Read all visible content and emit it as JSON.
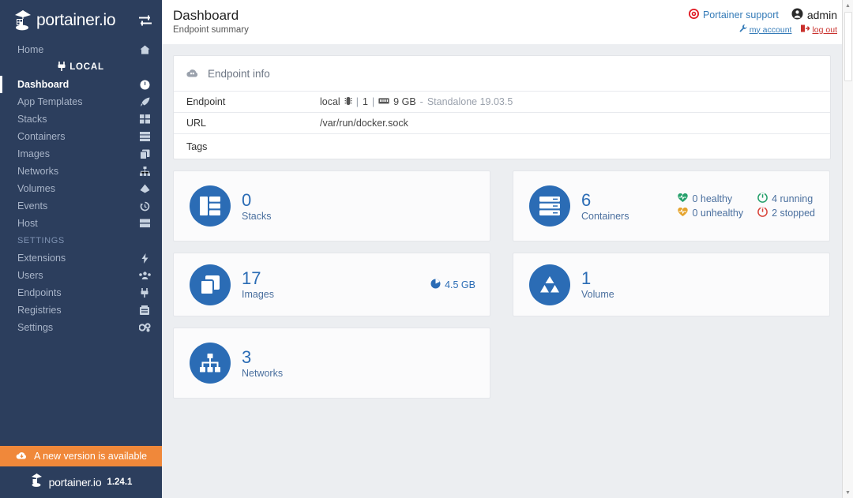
{
  "brand": {
    "name": "portainer.io",
    "toggle_icon": "sliders-toggle-icon",
    "logo_icon": "portainer-whale-logo"
  },
  "sidebar": {
    "home": {
      "label": "Home",
      "icon": "home-icon"
    },
    "local": {
      "label": "LOCAL",
      "icon": "plug-icon"
    },
    "items": [
      {
        "label": "Dashboard",
        "icon": "tachometer-icon",
        "active": true
      },
      {
        "label": "App Templates",
        "icon": "rocket-icon",
        "active": false
      },
      {
        "label": "Stacks",
        "icon": "stacks-grid-icon",
        "active": false
      },
      {
        "label": "Containers",
        "icon": "containers-icon",
        "active": false
      },
      {
        "label": "Images",
        "icon": "images-layers-icon",
        "active": false
      },
      {
        "label": "Networks",
        "icon": "network-sitemap-icon",
        "active": false
      },
      {
        "label": "Volumes",
        "icon": "volumes-icon",
        "active": false
      },
      {
        "label": "Events",
        "icon": "history-clock-icon",
        "active": false
      },
      {
        "label": "Host",
        "icon": "server-icon",
        "active": false
      }
    ],
    "settings_heading": "SETTINGS",
    "settings_items": [
      {
        "label": "Extensions",
        "icon": "bolt-icon"
      },
      {
        "label": "Users",
        "icon": "users-icon"
      },
      {
        "label": "Endpoints",
        "icon": "plug-icon"
      },
      {
        "label": "Registries",
        "icon": "registry-icon"
      },
      {
        "label": "Settings",
        "icon": "gear-icon"
      }
    ],
    "update_banner": {
      "label": "A new version is available",
      "icon": "cloud-download-icon",
      "color": "#f0883a"
    },
    "footer": {
      "brand": "portainer.io",
      "version": "1.24.1",
      "logo_icon": "portainer-whale-logo"
    }
  },
  "header": {
    "title": "Dashboard",
    "subtitle": "Endpoint summary",
    "support_label": "Portainer support",
    "support_icon": "lifebuoy-icon",
    "user_name": "admin",
    "user_icon": "user-circle-icon",
    "account_label": "my account",
    "account_icon": "wrench-icon",
    "logout_label": "log out",
    "logout_icon": "sign-out-icon"
  },
  "endpoint_panel": {
    "heading": "Endpoint info",
    "heading_icon": "docker-cloud-icon",
    "rows": [
      {
        "key": "Endpoint",
        "value": "local",
        "cpu_icon": "cpu-icon",
        "cpu": "1",
        "mem_icon": "memory-icon",
        "mem": "9 GB",
        "engine": "Standalone 19.03.5"
      },
      {
        "key": "URL",
        "value": "/var/run/docker.sock"
      },
      {
        "key": "Tags",
        "value": ""
      }
    ]
  },
  "cards": {
    "stacks": {
      "count": "0",
      "label": "Stacks",
      "icon": "stacks-grid-icon"
    },
    "containers": {
      "count": "6",
      "label": "Containers",
      "icon": "containers-icon",
      "statuses": [
        {
          "label": "0 healthy",
          "icon": "heartbeat-icon",
          "color": "#25a06b"
        },
        {
          "label": "4 running",
          "icon": "power-icon",
          "color": "#25a06b"
        },
        {
          "label": "0 unhealthy",
          "icon": "heartbeat-icon",
          "color": "#e5a32b"
        },
        {
          "label": "2 stopped",
          "icon": "power-icon",
          "color": "#d9453b"
        }
      ]
    },
    "images": {
      "count": "17",
      "label": "Images",
      "icon": "images-layers-icon",
      "size": "4.5 GB",
      "size_icon": "pie-chart-icon"
    },
    "volume": {
      "count": "1",
      "label": "Volume",
      "icon": "volumes-icon"
    },
    "networks": {
      "count": "3",
      "label": "Networks",
      "icon": "network-sitemap-icon"
    }
  },
  "colors": {
    "sidebar_bg": "#2c3e5d",
    "accent_blue": "#2b6cb5",
    "link_blue": "#337ab7",
    "update_orange": "#f0883a",
    "main_bg": "#eceef1"
  }
}
